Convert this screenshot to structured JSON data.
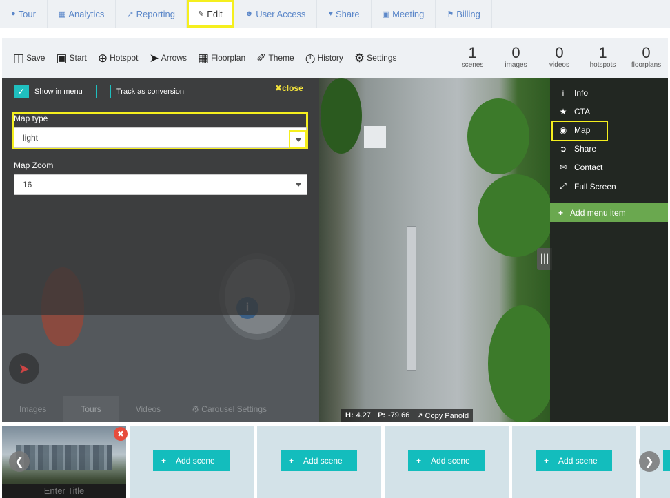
{
  "nav": {
    "tabs": [
      {
        "label": "Tour",
        "icon": "map-marker-icon"
      },
      {
        "label": "Analytics",
        "icon": "bar-chart-icon"
      },
      {
        "label": "Reporting",
        "icon": "line-chart-icon"
      },
      {
        "label": "Edit",
        "icon": "pencil-icon"
      },
      {
        "label": "User Access",
        "icon": "users-icon"
      },
      {
        "label": "Share",
        "icon": "heart-icon"
      },
      {
        "label": "Meeting",
        "icon": "monitor-icon"
      },
      {
        "label": "Billing",
        "icon": "lock-icon"
      }
    ],
    "active": "Edit"
  },
  "toolbar": {
    "tools": [
      {
        "label": "Save",
        "icon": "floppy-disk-icon"
      },
      {
        "label": "Start",
        "icon": "monitor-icon"
      },
      {
        "label": "Hotspot",
        "icon": "plus-circle-icon"
      },
      {
        "label": "Arrows",
        "icon": "arrow-circle-icon"
      },
      {
        "label": "Floorplan",
        "icon": "floorplan-icon"
      },
      {
        "label": "Theme",
        "icon": "paintbrush-icon"
      },
      {
        "label": "History",
        "icon": "clock-icon"
      },
      {
        "label": "Settings",
        "icon": "gear-icon"
      }
    ],
    "stats": [
      {
        "num": "1",
        "label": "scenes"
      },
      {
        "num": "0",
        "label": "images"
      },
      {
        "num": "0",
        "label": "videos"
      },
      {
        "num": "1",
        "label": "hotspots"
      },
      {
        "num": "0",
        "label": "floorplans"
      }
    ]
  },
  "panel": {
    "show_in_menu": "Show in menu",
    "track_conversion": "Track as conversion",
    "close": "close",
    "map_type_label": "Map type",
    "map_type_value": "light",
    "map_zoom_label": "Map Zoom",
    "map_zoom_value": "16"
  },
  "carousel": {
    "tabs": [
      "Images",
      "Tours",
      "Videos"
    ],
    "active": "Tours",
    "settings": "Carousel Settings"
  },
  "side_menu": {
    "items": [
      {
        "label": "Info",
        "icon": "info-icon"
      },
      {
        "label": "CTA",
        "icon": "star-icon"
      },
      {
        "label": "Map",
        "icon": "map-pin-icon"
      },
      {
        "label": "Share",
        "icon": "share-icon"
      },
      {
        "label": "Contact",
        "icon": "envelope-icon"
      },
      {
        "label": "Full Screen",
        "icon": "expand-icon"
      }
    ],
    "add_item": "Add menu item"
  },
  "status": {
    "h_label": "H:",
    "h_value": "4.27",
    "p_label": "P:",
    "p_value": "-79.66",
    "copy": "Copy PanoId"
  },
  "scenes": {
    "title_placeholder": "Enter Title",
    "add_label": "Add scene"
  },
  "colors": {
    "accent": "#13bdbd",
    "highlight": "#f5ef1e",
    "menu_add": "#6aa84f",
    "nav_link": "#5b87c9",
    "delete": "#e74c3c"
  }
}
